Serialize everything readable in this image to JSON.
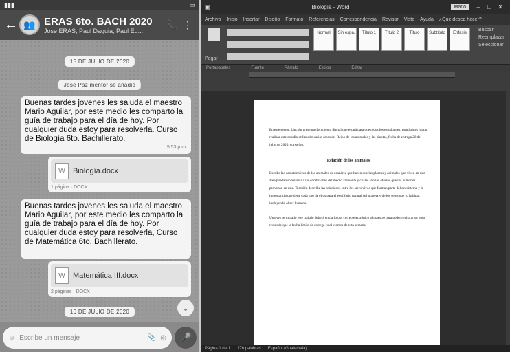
{
  "whatsapp": {
    "header": {
      "title": "ERAS 6to. BACH 2020",
      "subtitle": "Jose ERAS, Paul Daguia, Paul Ed..."
    },
    "date_top": "15 DE JULIO DE 2020",
    "system_added": "Jose Paz mentor se añadió",
    "messages": [
      {
        "text": "Buenas tardes jovenes les saluda el maestro Mario Aguilar, por este medio les comparto la guía de trabajo para el día de hoy. Por cualquier duda estoy para resolverla. Curso de Biología 6to. Bachillerato.",
        "time": "5:53 p.m."
      },
      {
        "text": "Buenas tardes jovenes les saluda el maestro Mario Aguilar, por este medio les comparto la guía de trabajo para el día de hoy. Por cualquier duda estoy para resolverla, Curso de Matemática 6to. Bachillerato.",
        "time": ""
      }
    ],
    "docs": [
      {
        "name": "Biología.docx",
        "meta": "1 página · DOCX"
      },
      {
        "name": "Matemática III.docx",
        "meta": "2 páginas · DOCX"
      }
    ],
    "date_bottom": "16 DE JULIO DE 2020",
    "input_placeholder": "Escribe un mensaje"
  },
  "word": {
    "title": "Biología - Word",
    "user": "Mario",
    "menu": [
      "Archivo",
      "Inicio",
      "Insertar",
      "Diseño",
      "Formato",
      "Referencias",
      "Correspondencia",
      "Revisar",
      "Vista",
      "Ayuda",
      "¿Qué desea hacer?"
    ],
    "paste_label": "Pegar",
    "style_tiles": [
      "Normal",
      "Sin espa.",
      "Título 1",
      "Título 2",
      "Título",
      "Subtítulo",
      "Énfasis"
    ],
    "right_tools": [
      "Buscar",
      "Reemplazar",
      "Seleccionar"
    ],
    "group_labels": [
      "Portapapeles",
      "Fuente",
      "Párrafo",
      "Estilos",
      "Editar"
    ],
    "paragraph_1": "En este sector, Lincoln presenta documento digital que estará para que todos los estudiantes, estudiantes lograr realizar este estudio utilizando varias áreas del Reino de los animales y las plantas, fecha de entrega 20 de julio de 2020, curso 6to.",
    "heading": "Relación de los animales",
    "paragraph_2": "Escribe las características de los animales de esta área que hacen que las plantas y animales que viven en esta área puedan sobrevivir a las condiciones del medio ambiente y cuáles son los efectos que los humanos provocan en este. También describe las relaciones entre los seres vivos que forman parte del ecosistema y la importancia que tiene cada uno de ellos para el equilibrio natural del planeta y de los seres que lo habitan, incluyendo al ser humano.",
    "paragraph_3": "Una vez terminado este trabajo deberá enviarlo por correo electrónico al maestro para poder registrar su nota, recuerde que la fecha límite de entrega es el viernes de esta semana.",
    "status": [
      "Página 1 de 1",
      "176 palabras",
      "Español (Guatemala)"
    ]
  }
}
